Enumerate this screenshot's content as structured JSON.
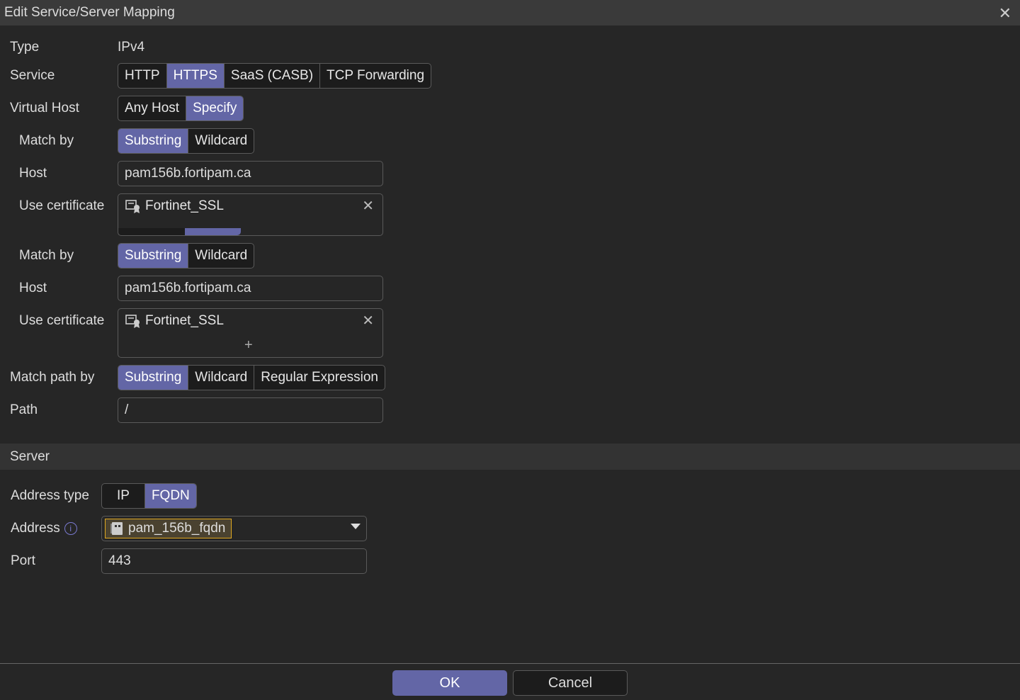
{
  "dialog": {
    "title": "Edit Service/Server Mapping"
  },
  "form": {
    "type_label": "Type",
    "type_value": "IPv4",
    "service_label": "Service",
    "service_options": [
      "HTTP",
      "HTTPS",
      "SaaS (CASB)",
      "TCP Forwarding"
    ],
    "service_selected": "HTTPS",
    "vhost_label": "Virtual Host",
    "vhost_options": [
      "Any Host",
      "Specify"
    ],
    "vhost_selected": "Specify",
    "hosts": [
      {
        "match_label": "Match by",
        "match_options": [
          "Substring",
          "Wildcard"
        ],
        "match_selected": "Substring",
        "host_label": "Host",
        "host_value": "pam156b.fortipam.ca",
        "cert_label": "Use certificate",
        "cert_value": "Fortinet_SSL"
      },
      {
        "match_label": "Match by",
        "match_options": [
          "Substring",
          "Wildcard"
        ],
        "match_selected": "Substring",
        "host_label": "Host",
        "host_value": "pam156b.fortipam.ca",
        "cert_label": "Use certificate",
        "cert_value": "Fortinet_SSL"
      }
    ],
    "path_match_label": "Match path by",
    "path_match_options": [
      "Substring",
      "Wildcard",
      "Regular Expression"
    ],
    "path_match_selected": "Substring",
    "path_label": "Path",
    "path_value": "/"
  },
  "server": {
    "section_title": "Server",
    "address_type_label": "Address type",
    "address_type_options": [
      "IP",
      "FQDN"
    ],
    "address_type_selected": "FQDN",
    "address_label": "Address",
    "address_value": "pam_156b_fqdn",
    "port_label": "Port",
    "port_value": "443"
  },
  "footer": {
    "ok": "OK",
    "cancel": "Cancel"
  },
  "colors": {
    "accent": "#6366a6",
    "background": "#262626",
    "highlight": "#e0a820"
  }
}
